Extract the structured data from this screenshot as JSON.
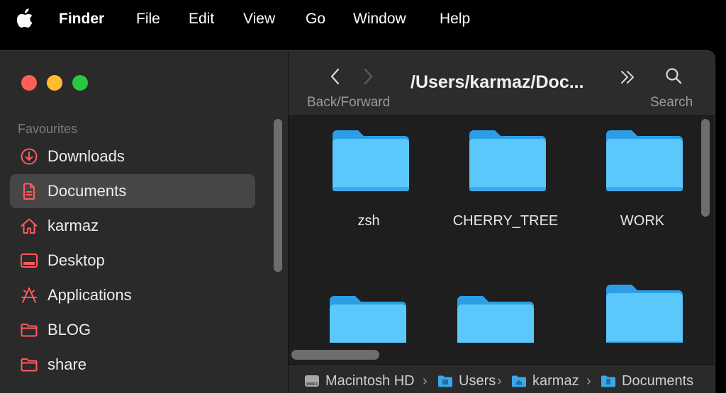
{
  "menubar": {
    "app_name": "Finder",
    "items": [
      "File",
      "Edit",
      "View",
      "Go",
      "Window",
      "Help"
    ]
  },
  "sidebar": {
    "section_label": "Favourites",
    "items": [
      {
        "label": "Downloads",
        "icon": "download-icon"
      },
      {
        "label": "Documents",
        "icon": "document-icon",
        "selected": true
      },
      {
        "label": "karmaz",
        "icon": "home-icon"
      },
      {
        "label": "Desktop",
        "icon": "desktop-icon"
      },
      {
        "label": "Applications",
        "icon": "applications-icon"
      },
      {
        "label": "BLOG",
        "icon": "folder-icon"
      },
      {
        "label": "share",
        "icon": "folder-icon"
      }
    ]
  },
  "toolbar": {
    "back_forward_label": "Back/Forward",
    "title": "/Users/karmaz/Doc...",
    "search_label": "Search"
  },
  "folders": [
    {
      "name": "zsh"
    },
    {
      "name": "CHERRY_TREE"
    },
    {
      "name": "WORK"
    },
    {
      "name": ""
    },
    {
      "name": ""
    },
    {
      "name": ""
    }
  ],
  "pathbar": {
    "items": [
      "Macintosh HD",
      "Users",
      "karmaz",
      "Documents"
    ]
  },
  "colors": {
    "accent_red": "#ff5a5f",
    "folder_blue": "#5ac8fa",
    "traffic_red": "#ff5f57",
    "traffic_yellow": "#febc2e",
    "traffic_green": "#28c840"
  }
}
